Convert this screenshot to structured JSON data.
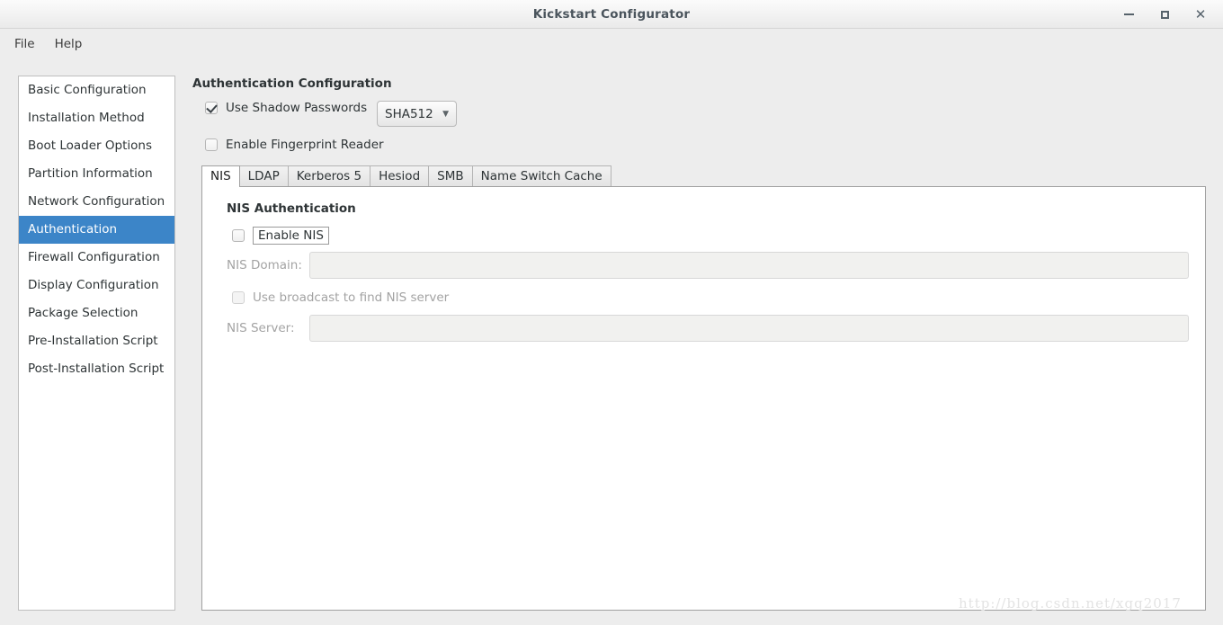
{
  "window": {
    "title": "Kickstart Configurator",
    "controls": [
      {
        "name": "minimize-button",
        "glyph": "minimize-icon",
        "label": "–"
      },
      {
        "name": "maximize-button",
        "glyph": "maximize-icon",
        "label": "□"
      },
      {
        "name": "close-button",
        "glyph": "close-icon",
        "label": "✕"
      }
    ]
  },
  "menubar": {
    "items": [
      {
        "label": "File"
      },
      {
        "label": "Help"
      }
    ]
  },
  "sidebar": {
    "items": [
      {
        "label": "Basic Configuration",
        "selected": false
      },
      {
        "label": "Installation Method",
        "selected": false
      },
      {
        "label": "Boot Loader Options",
        "selected": false
      },
      {
        "label": "Partition Information",
        "selected": false
      },
      {
        "label": "Network Configuration",
        "selected": false
      },
      {
        "label": "Authentication",
        "selected": true
      },
      {
        "label": "Firewall Configuration",
        "selected": false
      },
      {
        "label": "Display Configuration",
        "selected": false
      },
      {
        "label": "Package Selection",
        "selected": false
      },
      {
        "label": "Pre-Installation Script",
        "selected": false
      },
      {
        "label": "Post-Installation Script",
        "selected": false
      }
    ],
    "selected_color": "#3c85c8"
  },
  "main": {
    "section_title": "Authentication Configuration",
    "shadow_passwords": {
      "label": "Use Shadow Passwords",
      "checked": true
    },
    "hash_algorithm": {
      "value": "SHA512",
      "arrow": "chevron-down-icon"
    },
    "fingerprint_reader": {
      "label": "Enable Fingerprint Reader",
      "checked": false
    },
    "tabs": [
      {
        "label": "NIS",
        "active": true
      },
      {
        "label": "LDAP",
        "active": false
      },
      {
        "label": "Kerberos 5",
        "active": false
      },
      {
        "label": "Hesiod",
        "active": false
      },
      {
        "label": "SMB",
        "active": false
      },
      {
        "label": "Name Switch Cache",
        "active": false
      }
    ],
    "nis_panel": {
      "title": "NIS Authentication",
      "enable_nis": {
        "label": "Enable NIS",
        "checked": false,
        "focused": true
      },
      "domain": {
        "label": "NIS Domain:",
        "value": "",
        "placeholder": "",
        "enabled": false
      },
      "broadcast": {
        "label": "Use broadcast to find NIS server",
        "checked": false,
        "enabled": false
      },
      "server": {
        "label": "NIS Server:",
        "value": "",
        "placeholder": "",
        "enabled": false
      }
    }
  },
  "watermark": {
    "text": "http://blog.csdn.net/xgq2017"
  }
}
